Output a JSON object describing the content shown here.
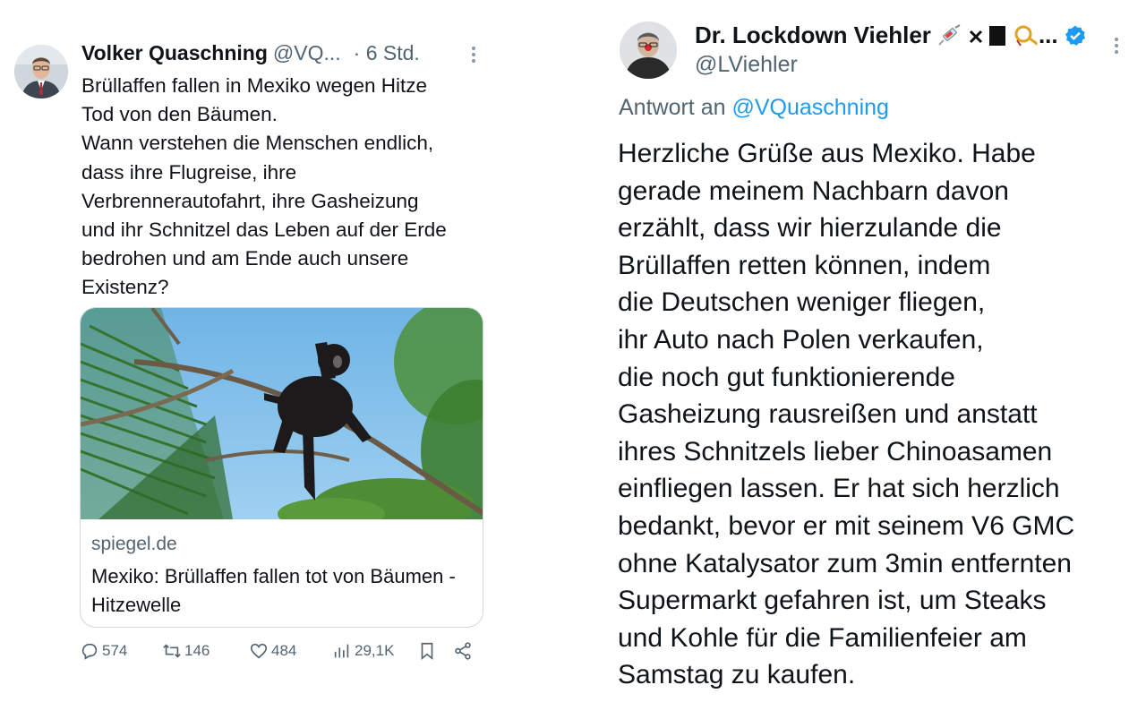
{
  "left_tweet": {
    "author_name": "Volker Quaschning",
    "author_handle": "@VQ...",
    "time": "· 6 Std.",
    "text_lines": [
      "Brüllaffen fallen in Mexiko wegen Hitze",
      "Tod von den Bäumen.",
      "Wann verstehen die Menschen endlich,",
      "dass ihre Flugreise, ihre",
      "Verbrennerautofahrt, ihre Gasheizung",
      "und ihr Schnitzel das Leben auf der Erde",
      "bedrohen und am Ende auch unsere",
      "Existenz?"
    ],
    "card": {
      "domain": "spiegel.de",
      "title": "Mexiko: Brüllaffen fallen tot von Bäumen - Hitzewelle"
    },
    "actions": {
      "replies": "574",
      "reposts": "146",
      "likes": "484",
      "views": "29,1K"
    }
  },
  "right_tweet": {
    "author_name": "Dr. Lockdown Viehler",
    "name_suffix": "...",
    "author_handle": "@LViehler",
    "reply_prefix": "Antwort an",
    "reply_to": "@VQuaschning",
    "text_lines": [
      "Herzliche Grüße aus Mexiko. Habe",
      "gerade meinem Nachbarn davon",
      "erzählt, dass wir hierzulande die",
      "Brüllaffen retten können, indem",
      "die Deutschen weniger fliegen,",
      "ihr Auto nach Polen verkaufen,",
      "die noch gut funktionierende",
      "Gasheizung rausreißen und anstatt",
      "ihres Schnitzels lieber Chinoasamen",
      "einfliegen lassen. Er hat sich herzlich",
      "bedankt, bevor er mit seinem V6 GMC",
      "ohne Katalysator zum 3min entfernten",
      "Supermarkt gefahren ist, um Steaks",
      "und Kohle für die Familienfeier am",
      "Samstag zu kaufen."
    ]
  },
  "colors": {
    "text": "#0f1419",
    "secondary": "#536471",
    "link": "#1d9bf0",
    "border": "#cfd9de"
  }
}
